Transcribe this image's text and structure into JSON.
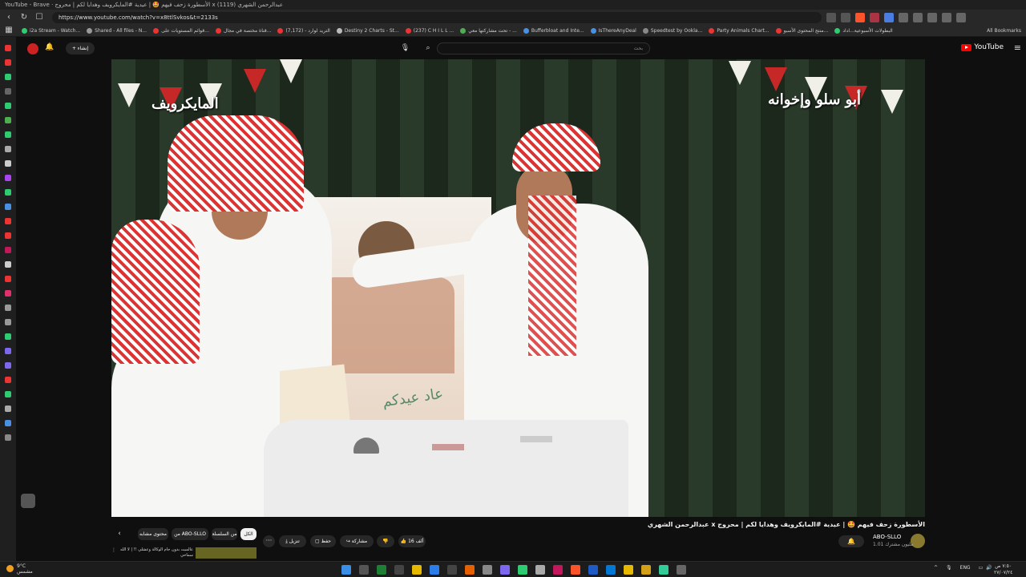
{
  "browser": {
    "title_bar": "YouTube - Brave · الأسطورة زحف فيهم 🤩 | عيدية #المايكرويف وهدايا لكم | محروج x عبدالرحمن الشهري (1119)",
    "url": "https://www.youtube.com/watch?v=x8ttlSvkos&t=2133s",
    "nav": {
      "back": "‹",
      "forward": "›",
      "reload": "↻"
    },
    "bookmarks": [
      {
        "label": "i2a Stream - Watch...",
        "color": "#2ecc71"
      },
      {
        "label": "Shared - All files - N...",
        "color": "#999999"
      },
      {
        "label": "قوائم المستويات على...",
        "color": "#e33"
      },
      {
        "label": "قناة مختصة في مجال...",
        "color": "#e33"
      },
      {
        "label": "التريد لوارد - (7,172)",
        "color": "#e33"
      },
      {
        "label": "Destiny 2 Charts - St...",
        "color": "#bbbbbb"
      },
      {
        "label": "(237) C H I L L ...",
        "color": "#e33"
      },
      {
        "label": "تحت مشاركتها معي - ...",
        "color": "#4caf50"
      },
      {
        "label": "Bufferbloat and Inte...",
        "color": "#4a90e2"
      },
      {
        "label": "IsThereAnyDeal",
        "color": "#4a90e2"
      },
      {
        "label": "Speedtest by Ookla...",
        "color": "#888888"
      },
      {
        "label": "Party Animals Chart...",
        "color": "#e33"
      },
      {
        "label": "منتج المحتوى الأسبو...",
        "color": "#e33"
      },
      {
        "label": "البطولات الأسبوعية...اداد",
        "color": "#2ecc71"
      }
    ],
    "all_bookmarks": "All Bookmarks"
  },
  "youtube": {
    "logo": "YouTube",
    "search_placeholder": "بحث",
    "create_label": "إنشاء",
    "video": {
      "title": "الأسطورة زحف فيهم 🤩 | عيدية #المايكرويف وهدايا لكم | محروج x عبدالرحمن الشهري",
      "watermark_left": "المايكرويف",
      "watermark_right": "أبو سلو وإخوانه",
      "poster_text": "عاد عيدكم"
    },
    "channel": {
      "name": "ABO-SLLO",
      "subscribers": "1.01 مليون مشترك"
    },
    "actions": {
      "likes": "16 ألف",
      "share": "مشاركة",
      "save": "حفظ",
      "download": "تنزيل",
      "more": "···"
    },
    "chips": [
      "الكل",
      "من السلسلة",
      "من ABO-SLLO",
      "محتوى مشابه"
    ],
    "up_next": {
      "title": "عالميت بدون جام الوكالة وعشلي !! | لا الله سماحي"
    }
  },
  "taskbar": {
    "weather_temp": "9°C",
    "weather_desc": "مشمس",
    "lang": "ENG",
    "time": "٧:٥٠ ص",
    "date": "٢٧/٠٧/٢٤"
  }
}
